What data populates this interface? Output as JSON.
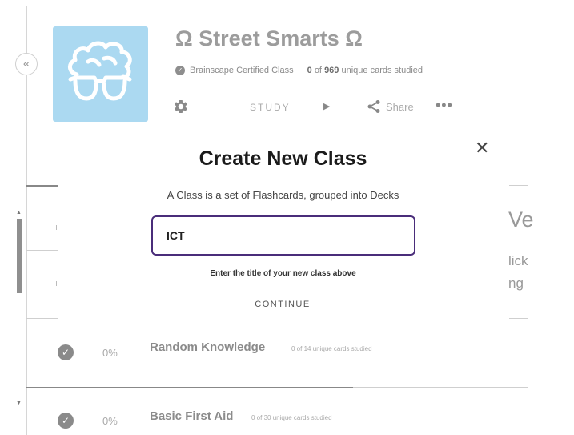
{
  "sidebar": {
    "collapse_glyph": "«"
  },
  "header": {
    "title": "Ω Street Smarts Ω",
    "certified_label": "Brainscape Certified Class",
    "studied_count": "0",
    "studied_of": "of",
    "total_cards": "969",
    "studied_suffix": "unique cards studied",
    "study_label": "STUDY",
    "share_label": "Share"
  },
  "decks": [
    {
      "percent": "0%",
      "name": "Random Knowledge",
      "sub": "0 of 14 unique cards studied"
    },
    {
      "percent": "0%",
      "name": "Basic First Aid",
      "sub": "0 of 30 unique cards studied"
    }
  ],
  "right_panel": {
    "heading_fragment": "Ve",
    "line1": "lick",
    "line2": "ng"
  },
  "modal": {
    "title": "Create New Class",
    "description": "A Class is a set of Flashcards, grouped into Decks",
    "input_value": "ICT",
    "hint": "Enter the title of your new class above",
    "continue_label": "CONTINUE",
    "close_glyph": "✕"
  },
  "colors": {
    "accent_border": "#4a2d7a",
    "thumbnail_bg": "#abd9f1"
  },
  "icons": [
    "brain-glasses-icon",
    "check-badge-icon",
    "gear-icon",
    "play-icon",
    "share-icon",
    "more-icon",
    "close-icon",
    "collapse-icon"
  ]
}
